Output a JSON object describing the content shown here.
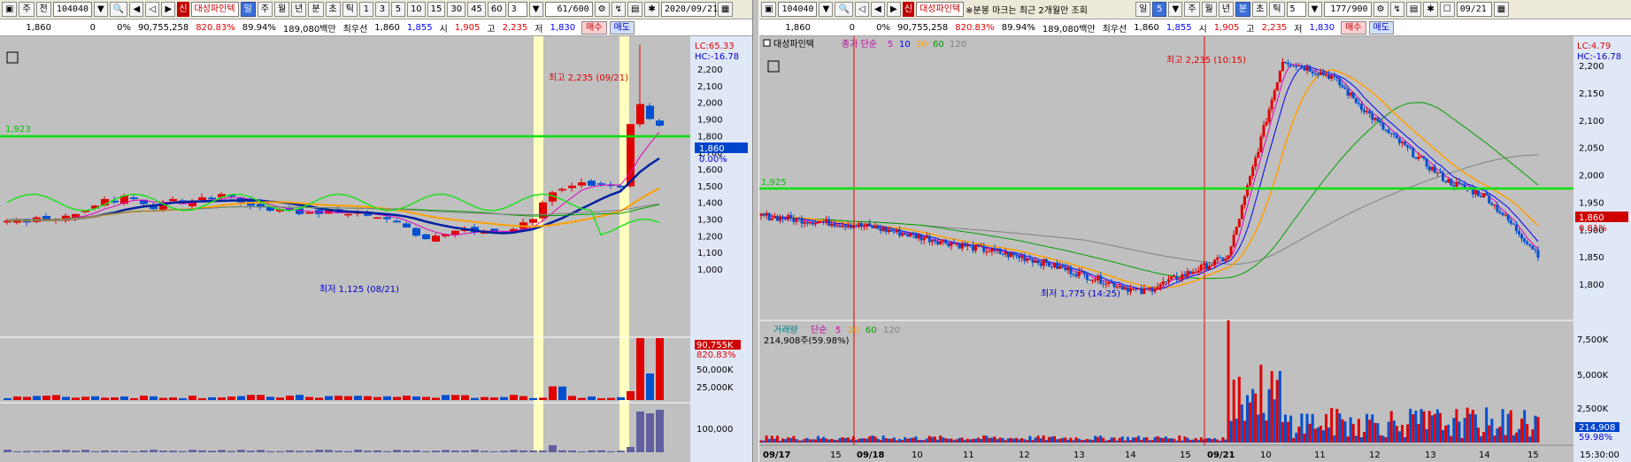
{
  "toolbar_left": {
    "buttons_nav": [
      "주",
      "전"
    ],
    "code": "104040",
    "sin": "신",
    "name": "대성파인텍",
    "periods": [
      "일",
      "주",
      "월",
      "년",
      "분",
      "초",
      "틱"
    ],
    "active_period": "일",
    "intervals": [
      "1",
      "3",
      "5",
      "10",
      "15",
      "30",
      "45",
      "60"
    ],
    "interval_select": "3",
    "count": "61/600",
    "date": "2020/09/21"
  },
  "toolbar_right": {
    "code": "104040",
    "sin": "신",
    "name": "대성파인텍",
    "note": "※분봉 마크는 최근 2개월만 조회",
    "period_select": "일",
    "period_num": "5",
    "periods": [
      "주",
      "월",
      "년",
      "분",
      "초",
      "틱"
    ],
    "active_period": "분",
    "interval_select": "5",
    "count": "177/900",
    "date": "09/21"
  },
  "quote": {
    "price": "1,860",
    "change": "0",
    "change_pct": "0%",
    "volume": "90,755,258",
    "vol_ratio": "820.83%",
    "turnover": "89.94%",
    "amount": "189,080백만",
    "best_ask_label": "최우선",
    "best_ask": "1,860",
    "best_bid": "1,855",
    "open_label": "시",
    "open": "1,905",
    "high_label": "고",
    "high": "2,235",
    "low_label": "저",
    "low": "1,830",
    "buy": "매수",
    "sell": "매도"
  },
  "left_chart": {
    "lc": "LC:65.33",
    "hc": "HC:-16.78",
    "line_label": "1,923",
    "max_label": "최고 2,235 (09/21)",
    "min_label": "최저 1,125 (08/21)",
    "price_badge": "1,860",
    "pct_badge": "0.00%",
    "y_ticks": [
      "2,200",
      "2,100",
      "2,000",
      "1,900",
      "1,800",
      "1,700",
      "1,600",
      "1,500",
      "1,400",
      "1,300",
      "1,200",
      "1,100",
      "1,000"
    ],
    "vol_badge": "90,755K",
    "vol_pct": "820.83%",
    "vol_ticks": [
      "50,000K",
      "25,000K"
    ],
    "sub_ticks": [
      "100,000"
    ]
  },
  "right_chart": {
    "title": "대성파인텍",
    "ma_label": "종가 단순",
    "ma_periods": [
      "5",
      "10",
      "20",
      "60",
      "120"
    ],
    "ma_colors": [
      "#e000c0",
      "#0000ff",
      "#ffa000",
      "#00a000",
      "#808080"
    ],
    "lc": "LC:4.79",
    "hc": "HC:-16.78",
    "line_label": "1,925",
    "max_label": "최고 2,235 (10:15)",
    "min_label": "최저 1,775 (14:25)",
    "price_badge": "1,860",
    "pct_badge": "0.81%",
    "y_ticks": [
      "2,200",
      "2,150",
      "2,100",
      "2,050",
      "2,000",
      "1,950",
      "1,900",
      "1,850",
      "1,800"
    ],
    "vol_title": "거래량",
    "vol_ma_label": "단순",
    "vol_ma_periods": [
      "5",
      "20",
      "60",
      "120"
    ],
    "vol_info": "214,908주(59.98%)",
    "vol_badge": "214,908",
    "vol_pct": "59.98%",
    "vol_ticks": [
      "7,500K",
      "5,000K",
      "2,500K"
    ],
    "x_labels": [
      "09/17",
      "15",
      "09/18",
      "10",
      "11",
      "12",
      "13",
      "14",
      "15",
      "09/21",
      "10",
      "11",
      "12",
      "13",
      "14",
      "15"
    ],
    "time": "15:30:00"
  }
}
